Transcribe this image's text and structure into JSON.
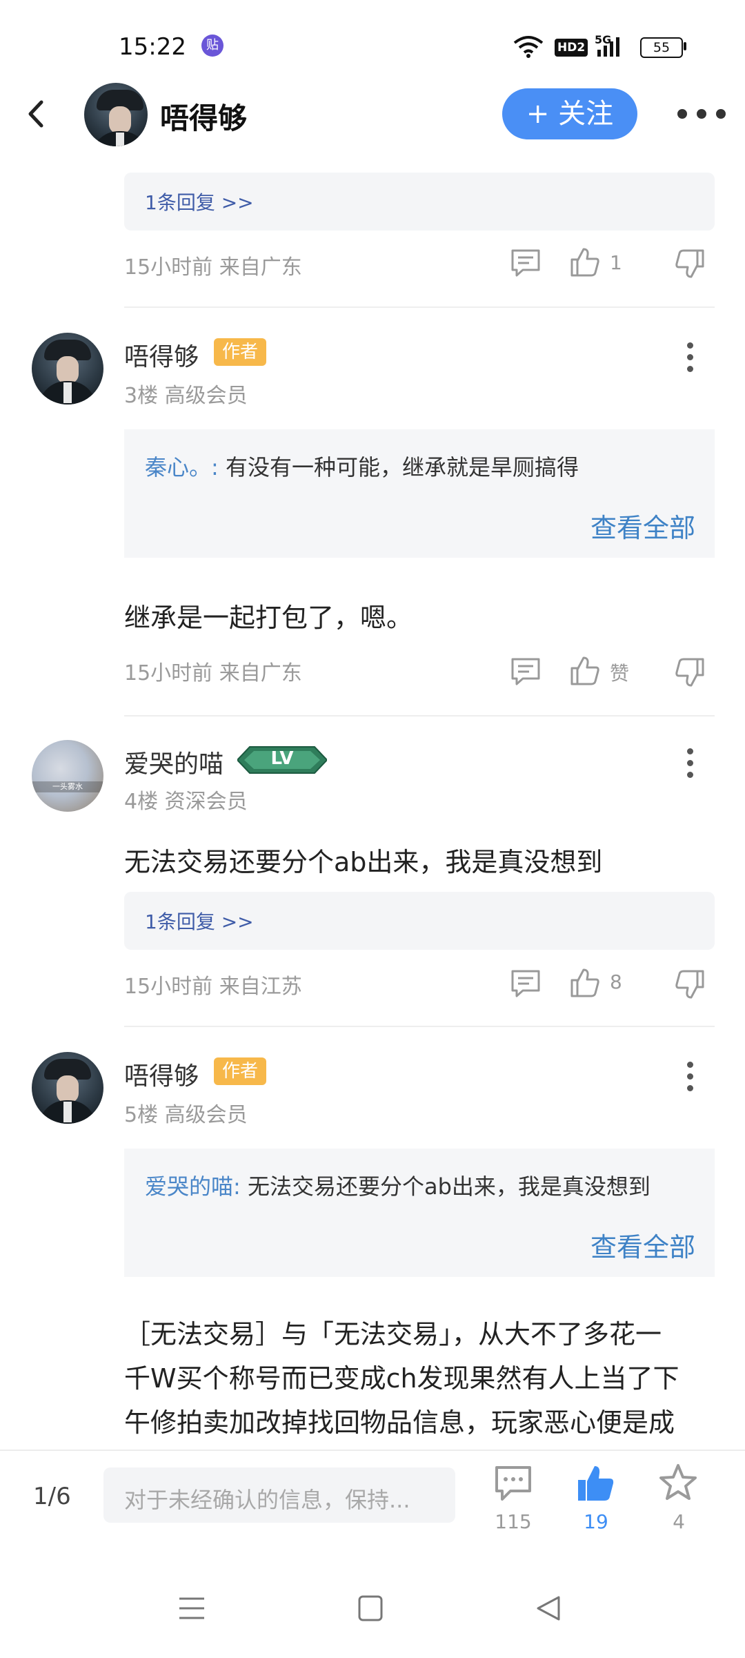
{
  "status_bar": {
    "time": "15:22",
    "app_badge": "贴",
    "network": "5G",
    "hd": "HD2",
    "battery": "55",
    "icons": [
      "wifi-icon",
      "hd-icon",
      "signal-5g-icon",
      "battery-icon"
    ]
  },
  "header": {
    "back_icon": "chevron-left-icon",
    "title": "唔得够",
    "follow_label": "+ 关注",
    "more_icon": "more-horizontal-icon",
    "accent": "#4a8ff5"
  },
  "floors": [
    {
      "partial": true,
      "reply_link": "1条回复 >>",
      "meta": "15小时前 来自广东",
      "like_count": "1"
    },
    {
      "name": "唔得够",
      "author_tag": "作者",
      "sub": "3楼 高级会员",
      "quote_author": "秦心。:",
      "quote_text": " 有没有一种可能，继承就是旱厕搞得",
      "see_all": "查看全部",
      "content": "继承是一起打包了，嗯。",
      "meta": "15小时前 来自广东",
      "like_count": "赞"
    },
    {
      "name": "爱哭的喵",
      "badge": "LV",
      "avatar_caption": "一头雾水",
      "sub": "4楼 资深会员",
      "content": "无法交易还要分个ab出来，我是真没想到",
      "reply_link": "1条回复 >>",
      "meta": "15小时前 来自江苏",
      "like_count": "8"
    },
    {
      "name": "唔得够",
      "author_tag": "作者",
      "sub": "5楼 高级会员",
      "quote_author": "爱哭的喵:",
      "quote_text": " 无法交易还要分个ab出来，我是真没想到",
      "see_all": "查看全部",
      "content_lines": [
        "［无法交易］与「无法交易」，从大不了多花一",
        "千W买个称号而已变成ch发现果然有人上当了下",
        "午修拍卖加改掉找回物品信息，玩家恶心便是成"
      ]
    }
  ],
  "bottom_bar": {
    "page_indicator": "1/6",
    "input_placeholder": "对于未经确认的信息，保持...",
    "comment_count": "115",
    "like_count": "19",
    "star_count": "4",
    "like_color": "#3d8ef5"
  },
  "nav_bar": {
    "icons": [
      "menu-nav-icon",
      "home-nav-icon",
      "back-nav-icon"
    ]
  }
}
